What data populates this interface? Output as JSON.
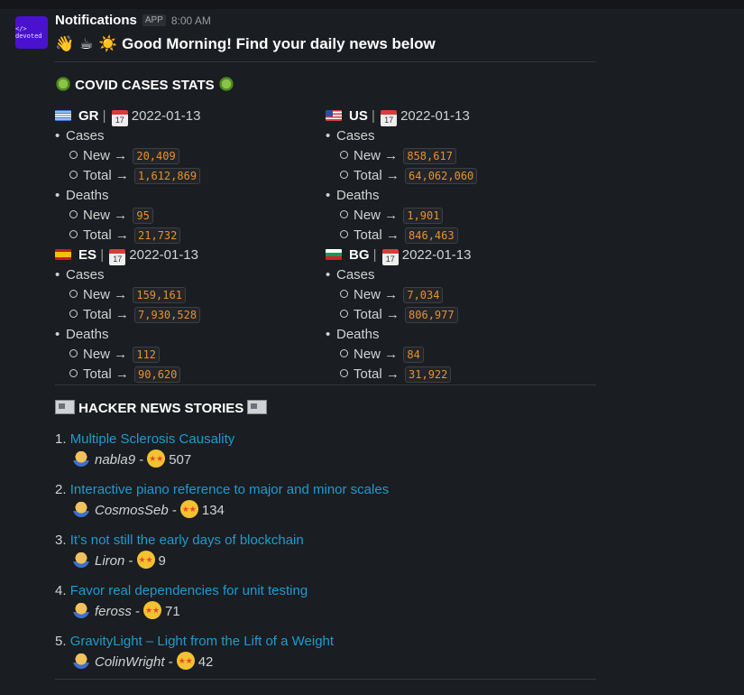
{
  "message": {
    "sender": "Notifications",
    "badge": "APP",
    "time": "8:00 AM",
    "avatar_text": "</> devoted",
    "greeting_emoji": "👋 ☕ ☀️",
    "greeting": "Good Morning! Find your daily news below"
  },
  "covid": {
    "title": "COVID CASES STATS",
    "countries": [
      {
        "code": "GR",
        "date": "2022-01-13",
        "cases_label": "Cases",
        "deaths_label": "Deaths",
        "new_label": "New →",
        "total_label": "Total →",
        "cases_new": "20,409",
        "cases_total": "1,612,869",
        "deaths_new": "95",
        "deaths_total": "21,732"
      },
      {
        "code": "US",
        "date": "2022-01-13",
        "cases_label": "Cases",
        "deaths_label": "Deaths",
        "new_label": "New →",
        "total_label": "Total →",
        "cases_new": "858,617",
        "cases_total": "64,062,060",
        "deaths_new": "1,901",
        "deaths_total": "846,463"
      },
      {
        "code": "ES",
        "date": "2022-01-13",
        "cases_label": "Cases",
        "deaths_label": "Deaths",
        "new_label": "New →",
        "total_label": "Total →",
        "cases_new": "159,161",
        "cases_total": "7,930,528",
        "deaths_new": "112",
        "deaths_total": "90,620"
      },
      {
        "code": "BG",
        "date": "2022-01-13",
        "cases_label": "Cases",
        "deaths_label": "Deaths",
        "new_label": "New →",
        "total_label": "Total →",
        "cases_new": "7,034",
        "cases_total": "806,977",
        "deaths_new": "84",
        "deaths_total": "31,922"
      }
    ]
  },
  "hn": {
    "title": "HACKER NEWS STORIES",
    "stories": [
      {
        "num": "1.",
        "title": "Multiple Sclerosis Causality",
        "author": "nabla9",
        "dash": "-",
        "score": "507"
      },
      {
        "num": "2.",
        "title": "Interactive piano reference to major and minor scales",
        "author": "CosmosSeb",
        "dash": "-",
        "score": "134"
      },
      {
        "num": "3.",
        "title": "It’s not still the early days of blockchain",
        "author": "Liron",
        "dash": "-",
        "score": "9"
      },
      {
        "num": "4.",
        "title": "Favor real dependencies for unit testing",
        "author": "feross",
        "dash": "-",
        "score": "71"
      },
      {
        "num": "5.",
        "title": "GravityLight – Light from the Lift of a Weight",
        "author": "ColinWright",
        "dash": "-",
        "score": "42"
      }
    ]
  },
  "colors": {
    "link": "#1d9bd1",
    "code_text": "#e8912d",
    "background": "#1a1d21",
    "avatar": "#4a12cf"
  }
}
